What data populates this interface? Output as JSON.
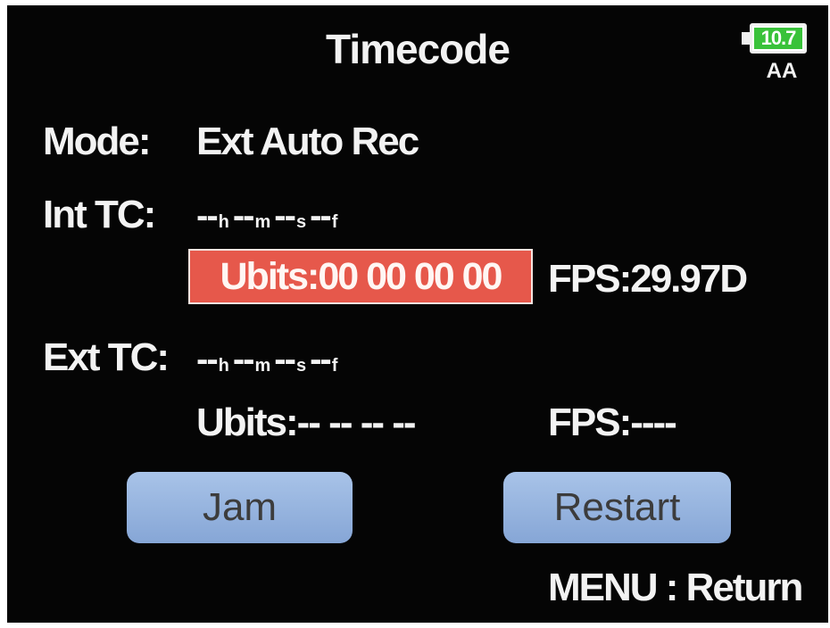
{
  "header": {
    "title": "Timecode"
  },
  "battery": {
    "level": "10.7",
    "type": "AA",
    "color": "#39c23a"
  },
  "mode": {
    "label": "Mode:",
    "value": "Ext Auto Rec"
  },
  "int_tc": {
    "label": "Int TC:",
    "timecode": {
      "h": "--",
      "h_unit": "h",
      "m": "--",
      "m_unit": "m",
      "s": "--",
      "s_unit": "s",
      "f": "--",
      "f_unit": "f"
    },
    "ubits": "Ubits:00 00 00 00",
    "fps": "FPS:29.97D"
  },
  "ext_tc": {
    "label": "Ext TC:",
    "timecode": {
      "h": "--",
      "h_unit": "h",
      "m": "--",
      "m_unit": "m",
      "s": "--",
      "s_unit": "s",
      "f": "--",
      "f_unit": "f"
    },
    "ubits": "Ubits:-- -- -- --",
    "fps": "FPS:----"
  },
  "buttons": {
    "jam": "Jam",
    "restart": "Restart"
  },
  "footer": {
    "hint": "MENU : Return"
  },
  "colors": {
    "highlight": "#e6584b",
    "button": "#a8c3e8",
    "background": "#050505"
  }
}
